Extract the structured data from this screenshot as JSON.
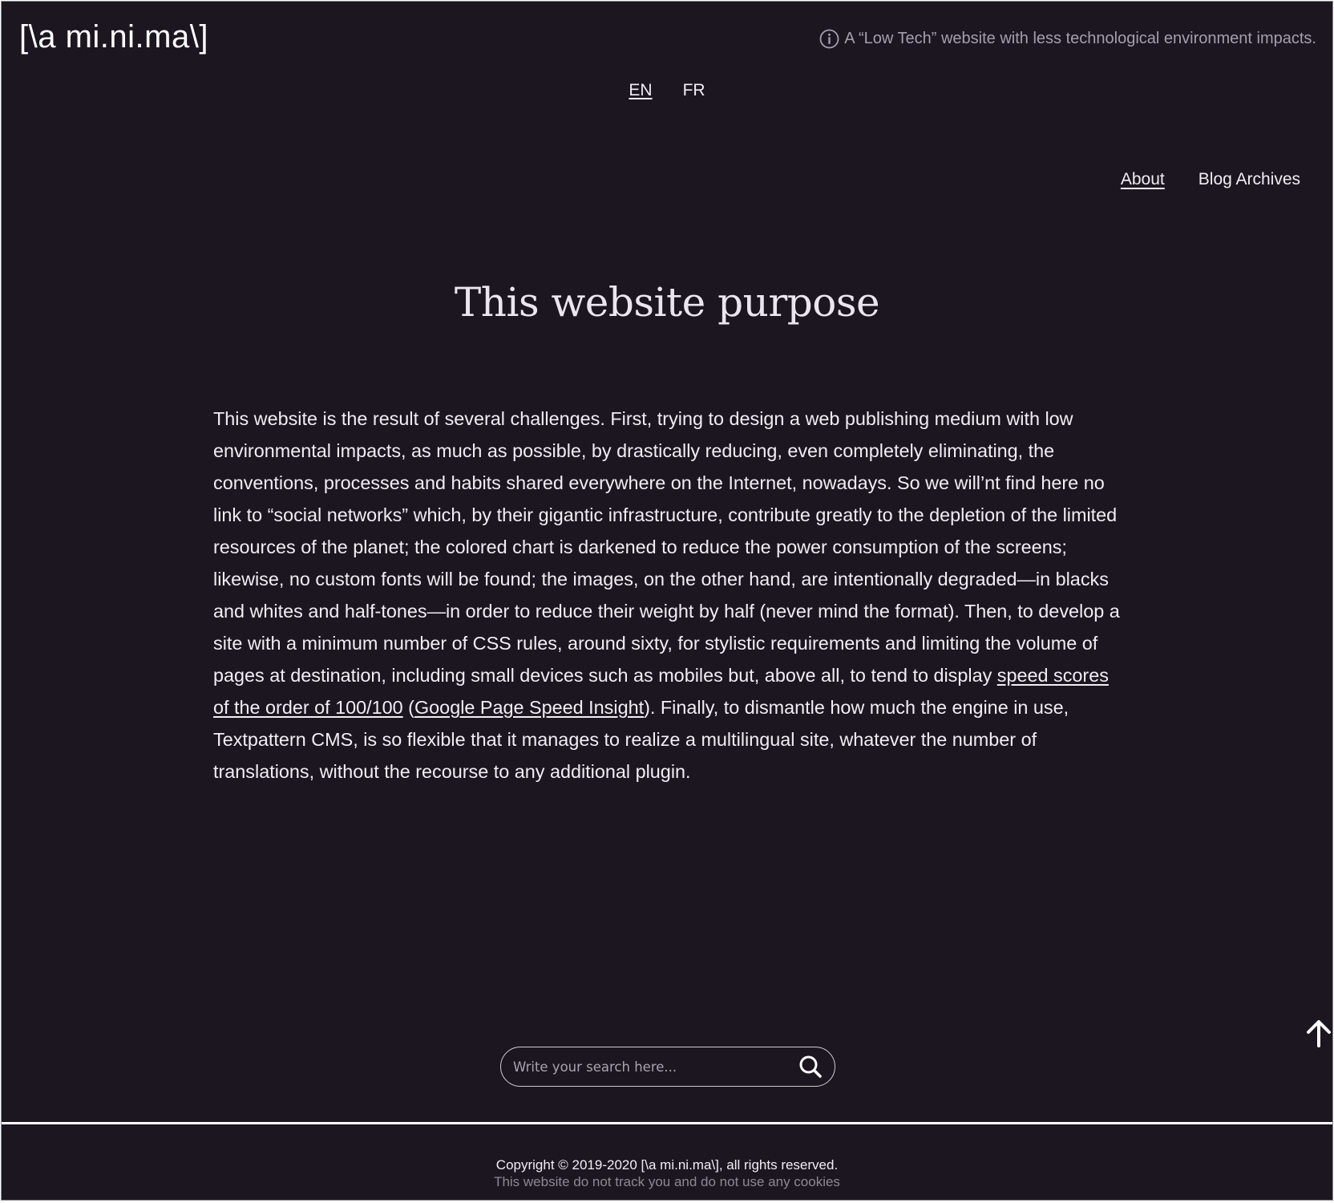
{
  "header": {
    "logo": "[\\a mi.ni.ma\\]",
    "tagline": "A “Low Tech” website with less technological environment impacts.",
    "languages": [
      {
        "label": "EN",
        "active": true
      },
      {
        "label": "FR",
        "active": false
      }
    ]
  },
  "nav": {
    "items": [
      {
        "label": "About",
        "current": true
      },
      {
        "label": "Blog Archives",
        "current": false
      }
    ]
  },
  "main": {
    "title": "This website purpose",
    "body": {
      "text_before_link": "This website is the result of several challenges. First, trying to design a web publishing medium with low environmental impacts, as much as possible, by drastically reducing, even completely eliminating, the conventions, processes and habits shared everywhere on the Internet, nowadays. So we will’nt find here no link to “social networks” which, by their gigantic infrastructure, contribute greatly to the de­pletion of the limited resources of the planet; the colored chart is darkened to reduce the power con­sumption of the screens; likewise, no custom fonts will be found; the images, on the other hand, are intentionally degraded—in blacks and whites and half-tones—in order to reduce their weight by half (never mind the format). Then, to develop a site with a minimum number of CSS rules, around sixty, for stylistic requirements and limiting the volume of pages at destination, including small devices such as mobiles but, above all, to tend to display ",
      "link_speed_scores": "speed scores of the order of 100/100",
      "paren_open": " (",
      "link_google": "Google Page Speed Insight",
      "text_after_link": "). Finally, to dismantle how much the engine in use, Textpattern CMS, is so flexible that it manages to realize a multilingual site, whatever the number of translations, without the recourse to any additional plugin."
    }
  },
  "search": {
    "placeholder": "Write your search here..."
  },
  "footer": {
    "copyright": "Copyright © 2019-2020 [\\a mi.ni.ma\\], all rights reserved.",
    "privacy": "This website do not track you and do not use any cookies"
  },
  "colors": {
    "background": "#1c1621",
    "text": "#f1eef3",
    "muted": "#a59fab"
  },
  "icons": {
    "tagline": "info-icon",
    "search": "search-icon",
    "back_to_top": "arrow-up-icon"
  }
}
